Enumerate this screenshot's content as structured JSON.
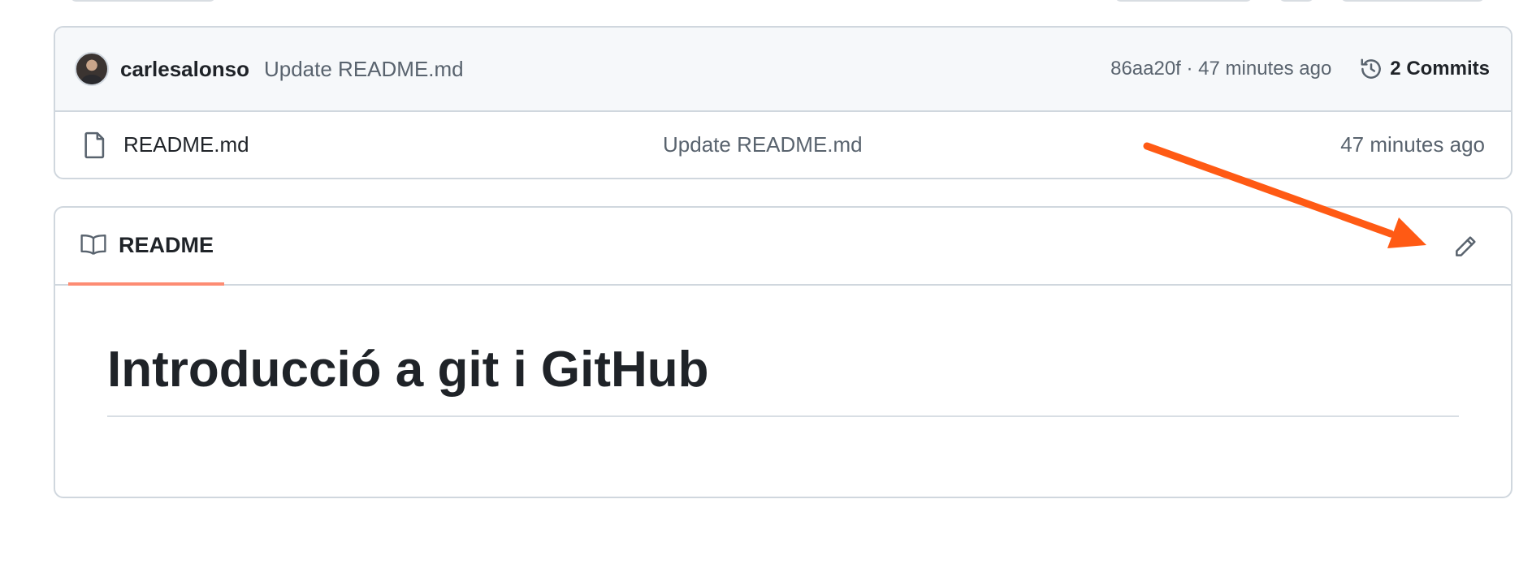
{
  "latest_commit": {
    "author": "carlesalonso",
    "message": "Update README.md",
    "meta": "86aa20f · 47 minutes ago",
    "history_label": "2 Commits"
  },
  "files": [
    {
      "name": "README.md",
      "commit_message": "Update README.md",
      "time": "47 minutes ago",
      "icon": "file-icon"
    }
  ],
  "readme": {
    "tab_label": "README",
    "title": "Introducció a git i GitHub",
    "edit_icon": "pencil-icon"
  },
  "colors": {
    "accent_tab_underline": "#fd8c73",
    "annotation_arrow": "#ff5a14",
    "border": "#d0d7de",
    "header_bg": "#f6f8fa"
  }
}
